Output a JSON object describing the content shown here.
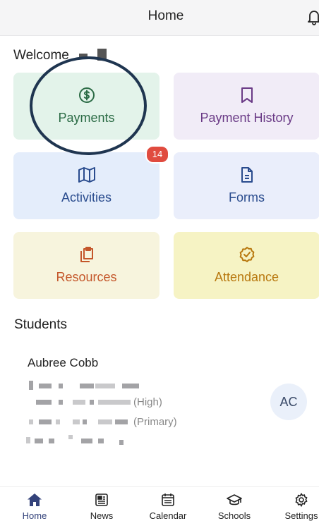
{
  "header": {
    "title": "Home",
    "icon": "bell-icon"
  },
  "welcome": {
    "text": "Welcome"
  },
  "tiles": [
    {
      "label": "Payments",
      "icon": "dollar-circle-icon",
      "color": "#2b6b45",
      "bg": "#e3f3ea"
    },
    {
      "label": "Payment History",
      "icon": "bookmark-icon",
      "color": "#6a3a86",
      "bg": "#f1ecf7"
    },
    {
      "label": "Activities",
      "icon": "map-icon",
      "color": "#2a4c8e",
      "bg": "#e4edfb",
      "badge": "14"
    },
    {
      "label": "Forms",
      "icon": "document-icon",
      "color": "#2a4c8e",
      "bg": "#eaeefb"
    },
    {
      "label": "Resources",
      "icon": "clipboard-icon",
      "color": "#c4562a",
      "bg": "#f7f4dd"
    },
    {
      "label": "Attendance",
      "icon": "check-badge-icon",
      "color": "#b8780f",
      "bg": "#f6f3c4"
    }
  ],
  "students": {
    "title": "Students",
    "items": [
      {
        "name": "Aubree Cobb",
        "school_tag_1": "(High)",
        "school_tag_2": "(Primary)",
        "initials": "AC"
      }
    ]
  },
  "tabs": [
    {
      "label": "Home",
      "icon": "house-icon",
      "active": true
    },
    {
      "label": "News",
      "icon": "newspaper-icon",
      "active": false
    },
    {
      "label": "Calendar",
      "icon": "calendar-icon",
      "active": false
    },
    {
      "label": "Schools",
      "icon": "graduation-cap-icon",
      "active": false
    },
    {
      "label": "Settings",
      "icon": "gear-icon",
      "active": false
    }
  ],
  "colors": {
    "badge": "#e04b3f",
    "active_tab": "#33427a",
    "annotation_ring": "#1f3550"
  }
}
